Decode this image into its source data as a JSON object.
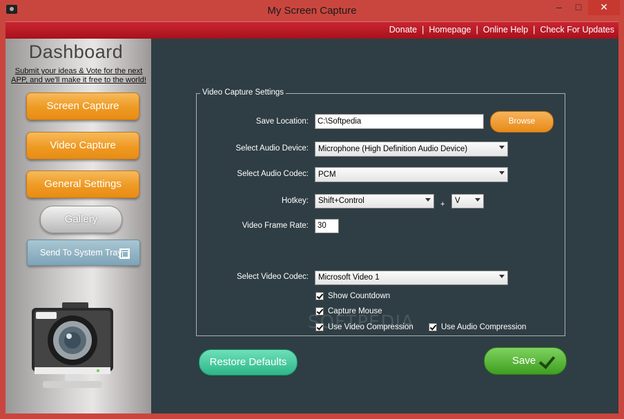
{
  "window": {
    "title": "My Screen Capture"
  },
  "menubar": {
    "links": [
      "Donate",
      "Homepage",
      "Online Help",
      "Check For Updates"
    ]
  },
  "sidebar": {
    "title": "Dashboard",
    "submit_line1": "Submit your ideas & Vote for the next",
    "submit_line2": "APP, and we'll make it free to the world!",
    "buttons": {
      "screen": "Screen Capture",
      "video": "Video Capture",
      "general": "General Settings",
      "gallery": "Gallery",
      "tray": "Send To System Tray"
    }
  },
  "settings": {
    "group_title": "Video Capture Settings",
    "save_location_label": "Save Location:",
    "save_location_value": "C:\\Softpedia",
    "browse_label": "Browse",
    "audio_device_label": "Select Audio Device:",
    "audio_device_value": "Microphone (High Definition Audio Device)",
    "audio_codec_label": "Select Audio Codec:",
    "audio_codec_value": "PCM",
    "hotkey_label": "Hotkey:",
    "hotkey_modifier": "Shift+Control",
    "hotkey_plus": "+",
    "hotkey_key": "V",
    "frame_rate_label": "Video Frame Rate:",
    "frame_rate_value": "30",
    "video_codec_label": "Select Video Codec:",
    "video_codec_value": "Microsoft Video 1",
    "show_countdown": "Show Countdown",
    "capture_mouse": "Capture Mouse",
    "use_video_compression": "Use Video Compression",
    "use_audio_compression": "Use Audio Compression"
  },
  "footer": {
    "restore_label": "Restore Defaults",
    "save_label": "Save"
  },
  "watermark": "SOFTPEDIA",
  "colors": {
    "titlebar": "#c9463f",
    "menubar": "#b81823",
    "main_bg": "#2f3e44",
    "orange": "#ee9a23",
    "green": "#3f9e21",
    "teal": "#2db689"
  }
}
